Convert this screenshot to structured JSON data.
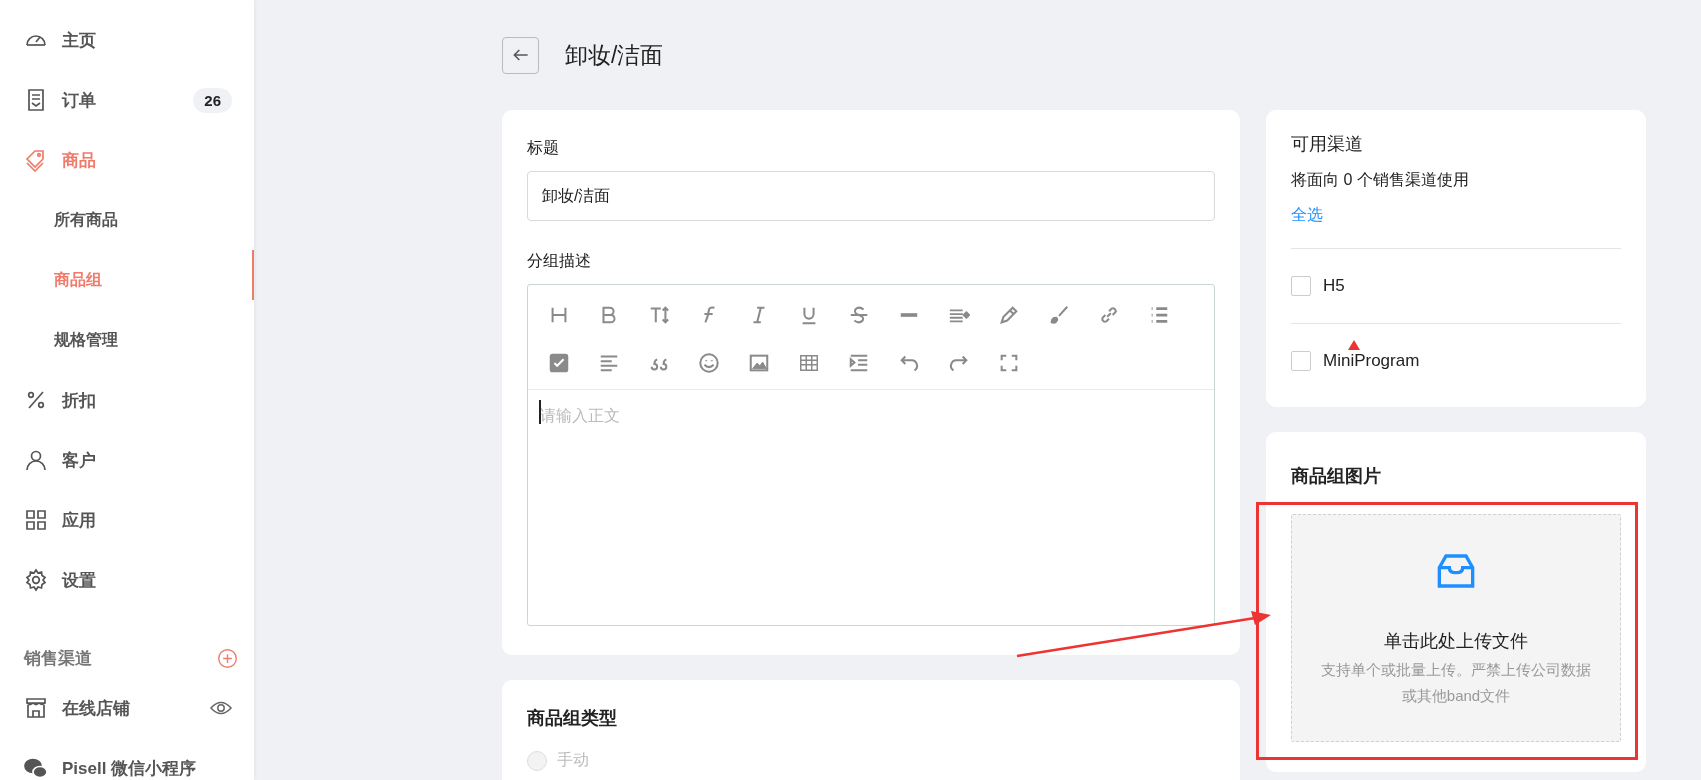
{
  "sidebar": {
    "items": [
      {
        "label": "主页",
        "selected": false
      },
      {
        "label": "订单",
        "selected": false,
        "badge": "26"
      },
      {
        "label": "商品",
        "selected": true,
        "children": [
          {
            "label": "所有商品",
            "selected": false
          },
          {
            "label": "商品组",
            "selected": true
          },
          {
            "label": "规格管理",
            "selected": false
          }
        ]
      },
      {
        "label": "折扣",
        "selected": false
      },
      {
        "label": "客户",
        "selected": false
      },
      {
        "label": "应用",
        "selected": false
      },
      {
        "label": "设置",
        "selected": false
      }
    ],
    "channels_title": "销售渠道",
    "channels": [
      {
        "label": "在线店铺"
      },
      {
        "label": "Pisell 微信小程序"
      }
    ]
  },
  "page": {
    "title": "卸妆/洁面"
  },
  "basic": {
    "title_label": "标题",
    "title_value": "卸妆/洁面",
    "desc_label": "分组描述",
    "placeholder": "请输入正文"
  },
  "type_card": {
    "title": "商品组类型",
    "options": [
      {
        "label": "手动",
        "selected": false
      }
    ]
  },
  "channels": {
    "title": "可用渠道",
    "summary": "将面向 0 个销售渠道使用",
    "select_all": "全选",
    "items": [
      {
        "label": "H5",
        "checked": false
      },
      {
        "label": "MiniProgram",
        "checked": false
      }
    ]
  },
  "image_card": {
    "title": "商品组图片",
    "upload_title": "单击此处上传文件",
    "upload_hint": "支持单个或批量上传。严禁上传公司数据或其他band文件"
  }
}
